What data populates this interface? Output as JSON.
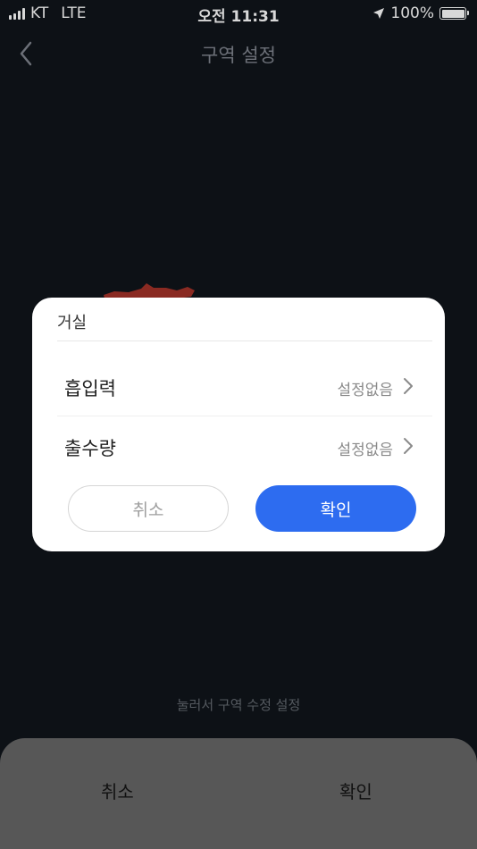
{
  "status_bar": {
    "carrier": "KT",
    "network": "LTE",
    "time": "오전 11:31",
    "battery": "100%",
    "battery_level": 1.0
  },
  "header": {
    "title": "구역 설정",
    "back_icon": "chevron-left-icon"
  },
  "hint": "눌러서 구역 수정 설정",
  "bottom_sheet": {
    "cancel_label": "취소",
    "confirm_label": "확인"
  },
  "modal": {
    "title": "거실",
    "rows": [
      {
        "label": "흡입력",
        "value": "설정없음",
        "icon": "chevron-right-icon"
      },
      {
        "label": "출수량",
        "value": "설정없음",
        "icon": "chevron-right-icon"
      }
    ],
    "cancel_label": "취소",
    "confirm_label": "확인"
  },
  "colors": {
    "background": "#0d1116",
    "accent": "#2d6cf0",
    "sheet": "#575757",
    "map_area": "#8a2a22"
  }
}
